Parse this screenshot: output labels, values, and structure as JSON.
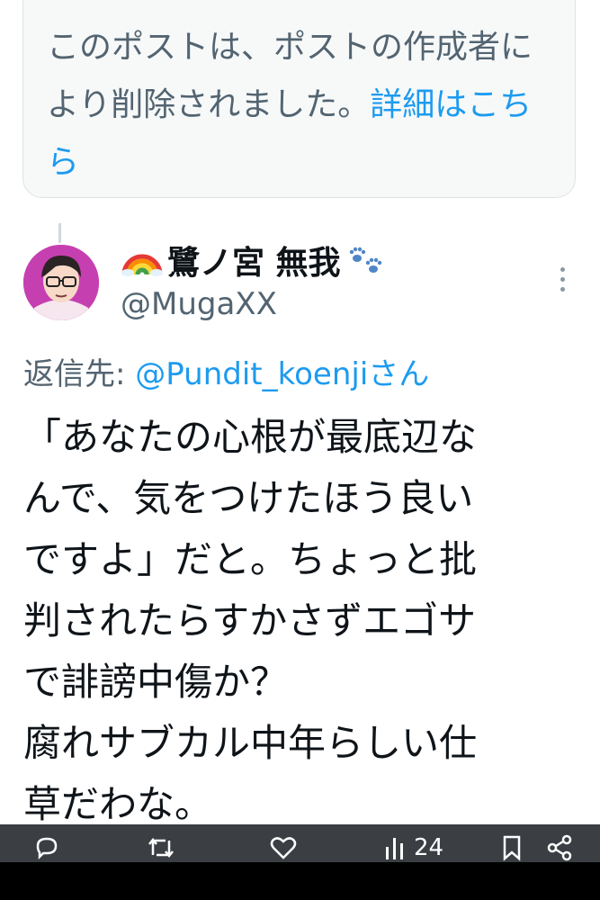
{
  "notice": {
    "text": "このポストは、ポストの作成者により削除されました。",
    "link": "詳細はこちら"
  },
  "author": {
    "display_name": "鷺ノ宮 無我",
    "handle": "@MugaXX",
    "badge_left": "rainbow-emoji",
    "badge_right": "paw-prints-emoji"
  },
  "reply": {
    "prefix": "返信先: ",
    "mention": "@Pundit_koenji",
    "suffix": "さん"
  },
  "post": {
    "lines": [
      "「あなたの心根が最底辺な",
      "んで、気をつけたほう良い",
      "ですよ」だと。ちょっと批",
      "判されたらすかさずエゴサ",
      "で誹謗中傷か？",
      "腐れサブカル中年らしい仕",
      "草だわな。"
    ]
  },
  "actions": {
    "views": "24"
  },
  "colors": {
    "link": "#1d9bf0",
    "secondary_text": "#536471",
    "avatar_bg": "#c63fb0"
  }
}
